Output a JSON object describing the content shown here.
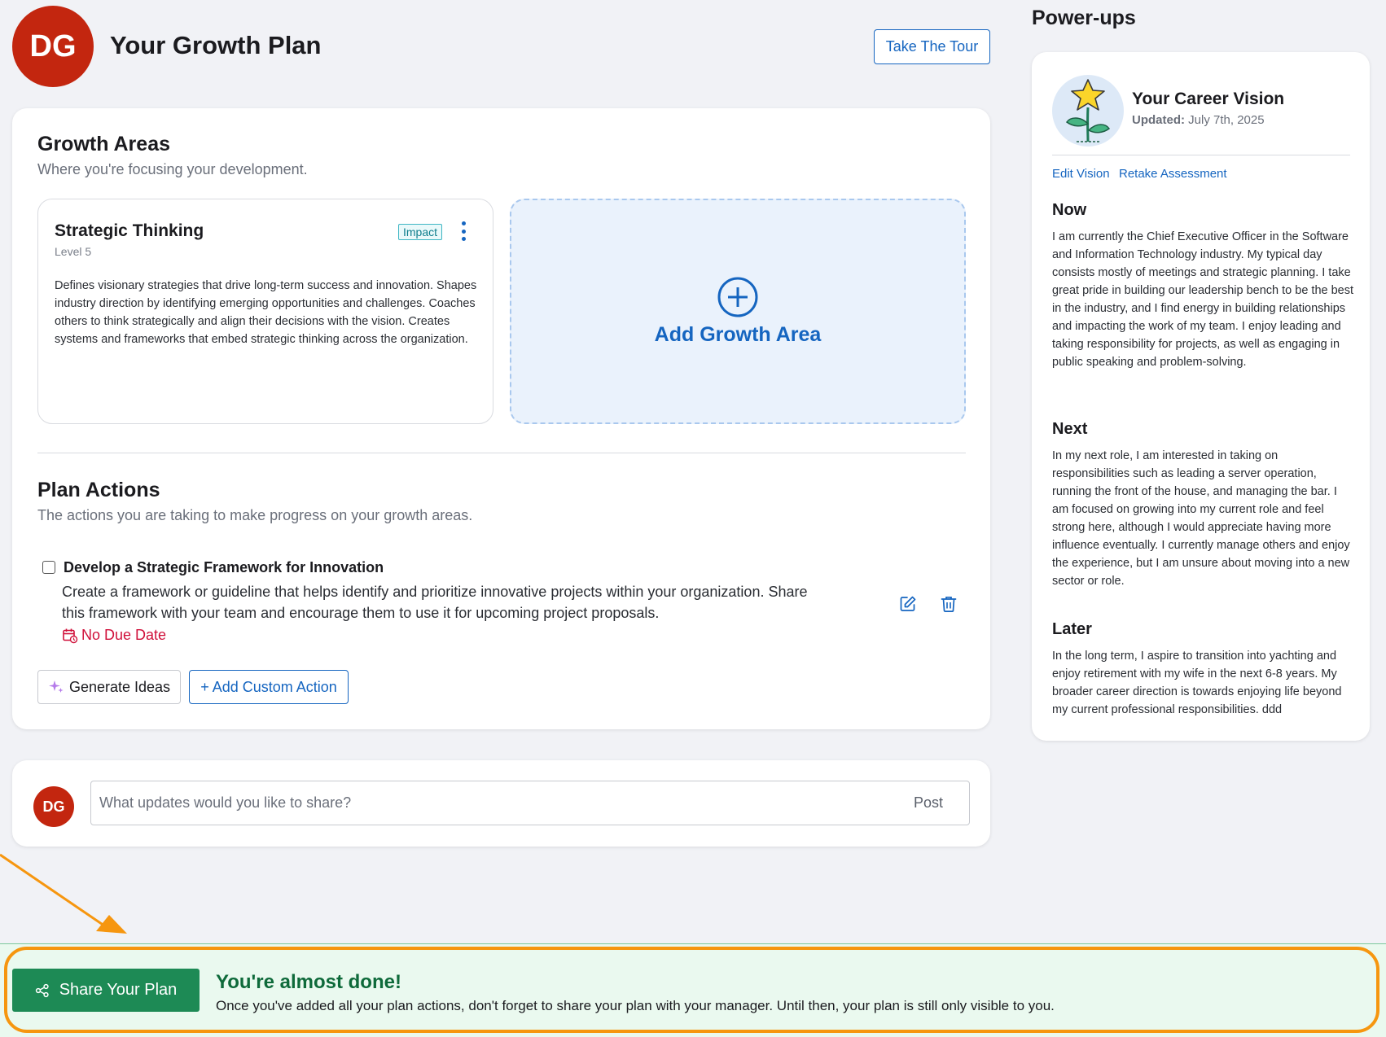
{
  "header": {
    "avatar_initials": "DG",
    "title": "Your Growth Plan",
    "tour_button": "Take The Tour"
  },
  "growth_areas": {
    "title": "Growth Areas",
    "subtitle": "Where you're focusing your development.",
    "items": [
      {
        "name": "Strategic Thinking",
        "level": "Level 5",
        "badge": "Impact",
        "description": "Defines visionary strategies that drive long-term success and innovation. Shapes industry direction by identifying emerging opportunities and challenges. Coaches others to think strategically and align their decisions with the vision. Creates systems and frameworks that embed strategic thinking across the organization."
      }
    ],
    "add_label": "Add Growth Area"
  },
  "plan_actions": {
    "title": "Plan Actions",
    "subtitle": "The actions you are taking to make progress on your growth areas.",
    "items": [
      {
        "title": "Develop a Strategic Framework for Innovation",
        "description": "Create a framework or guideline that helps identify and prioritize innovative projects within your organization. Share this framework with your team and encourage them to use it for upcoming project proposals.",
        "due": "No Due Date",
        "completed": false
      }
    ],
    "generate_button": "Generate Ideas",
    "custom_button": "+ Add Custom Action"
  },
  "post": {
    "avatar_initials": "DG",
    "placeholder": "What updates would you like to share?",
    "post_button": "Post"
  },
  "powerups": {
    "heading": "Power-ups",
    "vision": {
      "title": "Your Career Vision",
      "updated_label": "Updated:",
      "updated_date": "July 7th, 2025",
      "edit_link": "Edit Vision",
      "retake_link": "Retake Assessment",
      "now_title": "Now",
      "now_text": "I am currently the Chief Executive Officer in the Software and Information Technology industry. My typical day consists mostly of meetings and strategic planning. I take great pride in building our leadership bench to be the best in the industry, and I find energy in building relationships and impacting the work of my team. I enjoy leading and taking responsibility for projects, as well as engaging in public speaking and problem-solving.",
      "next_title": "Next",
      "next_text": "In my next role, I am interested in taking on responsibilities such as leading a server operation, running the front of the house, and managing the bar. I am focused on growing into my current role and feel strong here, although I would appreciate having more influence eventually. I currently manage others and enjoy the experience, but I am unsure about moving into a new sector or role.",
      "later_title": "Later",
      "later_text": "In the long term, I aspire to transition into yachting and enjoy retirement with my wife in the next 6-8 years. My broader career direction is towards enjoying life beyond my current professional responsibilities. ddd"
    }
  },
  "banner": {
    "share_button": "Share Your Plan",
    "title": "You're almost done!",
    "text": "Once you've added all your plan actions, don't forget to share your plan with your manager. Until then, your plan is still only visible to you."
  },
  "colors": {
    "brand_blue": "#1565c0",
    "avatar_red": "#c3260f",
    "share_green": "#1d8a55",
    "due_red": "#d0103a",
    "highlight_orange": "#f6960f"
  }
}
